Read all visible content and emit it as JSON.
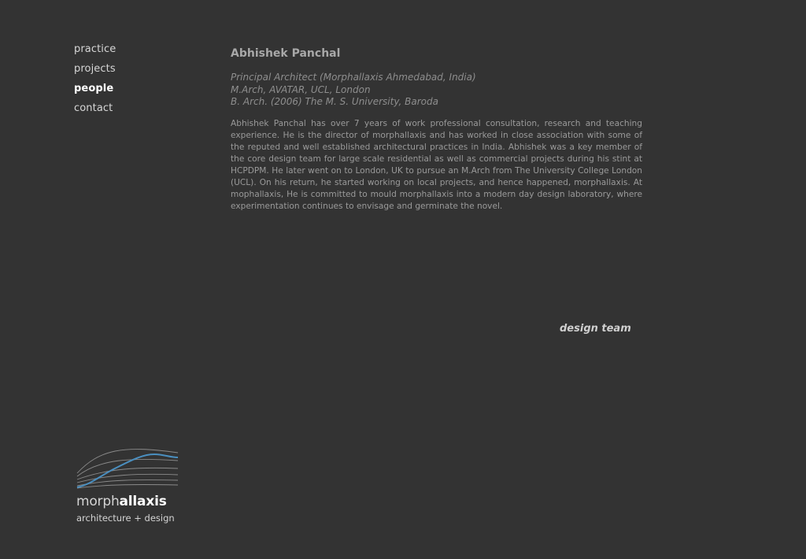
{
  "nav": {
    "items": [
      {
        "label": "practice",
        "active": false
      },
      {
        "label": "projects",
        "active": false
      },
      {
        "label": "people",
        "active": true
      },
      {
        "label": "contact",
        "active": false
      }
    ]
  },
  "profile": {
    "name": "Abhishek Panchal",
    "credentials": [
      "Principal Architect (Morphallaxis Ahmedabad, India)",
      "M.Arch, AVATAR, UCL, London",
      "B. Arch. (2006) The M. S. University, Baroda"
    ],
    "bio": "Abhishek Panchal has over 7 years of work professional consultation, research and teaching experience. He is the director of morphallaxis and has worked in close association with some of the reputed and well established architectural practices in India. Abhishek was a key member of the core design team for large scale residential as well as commercial projects during his stint at HCPDPM. He later went on to London, UK to pursue an M.Arch from The University College London (UCL). On his return, he started working on local projects, and hence happened, morphallaxis. At mophallaxis, He is committed to mould morphallaxis into a modern day design laboratory, where experimentation continues to envisage and germinate the novel."
  },
  "links": {
    "design_team": "design team"
  },
  "logo": {
    "word_light": "morph",
    "word_bold": "allaxis",
    "tagline": "architecture + design",
    "accent_color": "#4a8fc0",
    "line_color": "#8a8a8a"
  },
  "colors": {
    "background": "#333333",
    "nav_text": "#d6d6d6",
    "nav_active": "#ffffff",
    "body_text": "#9a9a9a"
  }
}
